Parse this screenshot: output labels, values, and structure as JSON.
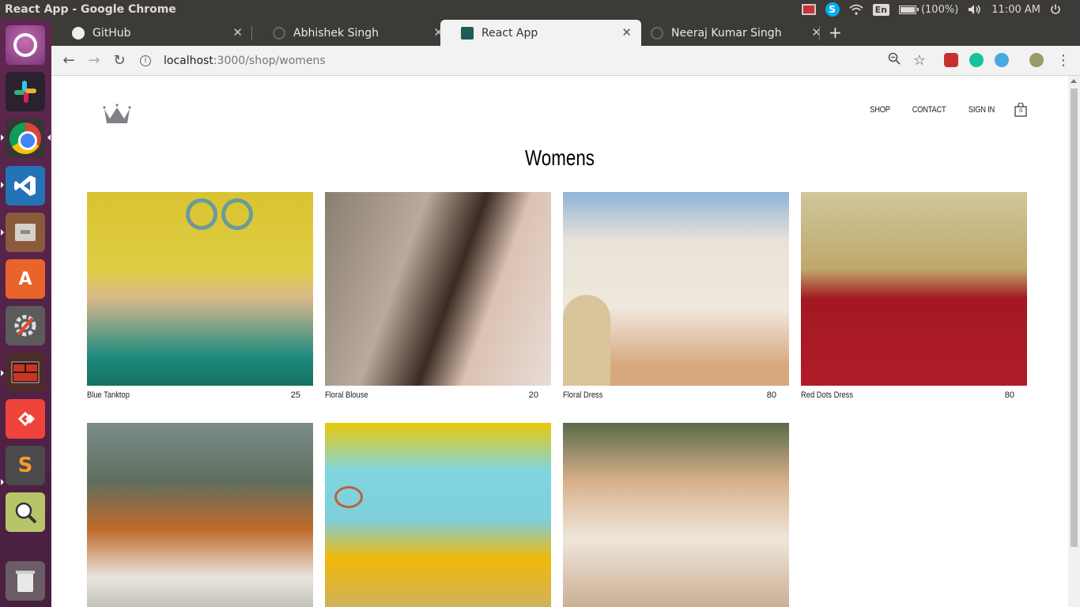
{
  "window_title": "React App - Google Chrome",
  "tray": {
    "language": "En",
    "battery": "(100%)",
    "clock": "11:00 AM"
  },
  "launcher": {
    "items": [
      "ubuntu-dash",
      "slack",
      "chrome",
      "vscode",
      "files",
      "software-center",
      "system-settings",
      "terminal",
      "anydesk",
      "sublime-text",
      "search-tool",
      "trash"
    ]
  },
  "browser": {
    "tabs": [
      {
        "title": "GitHub",
        "favicon": "github-icon"
      },
      {
        "title": "Abhishek Singh",
        "favicon": "loading-icon"
      },
      {
        "title": "React App",
        "favicon": "react-icon"
      },
      {
        "title": "Neeraj Kumar Singh",
        "favicon": "loading-icon"
      }
    ],
    "url_host": "localhost",
    "url_path": ":3000/shop/womens"
  },
  "site": {
    "nav": {
      "shop": "SHOP",
      "contact": "CONTACT",
      "signin": "SIGN IN",
      "cart_count": "0"
    },
    "title": "Womens",
    "items": [
      {
        "name": "Blue Tanktop",
        "price": "25"
      },
      {
        "name": "Floral Blouse",
        "price": "20"
      },
      {
        "name": "Floral Dress",
        "price": "80"
      },
      {
        "name": "Red Dots Dress",
        "price": "80"
      },
      {
        "name": "",
        "price": ""
      },
      {
        "name": "",
        "price": ""
      },
      {
        "name": "",
        "price": ""
      }
    ]
  },
  "colors": {
    "launcher": "#5e2750",
    "panel": "#3c3b37",
    "toolbar": "#f2f2f2"
  }
}
